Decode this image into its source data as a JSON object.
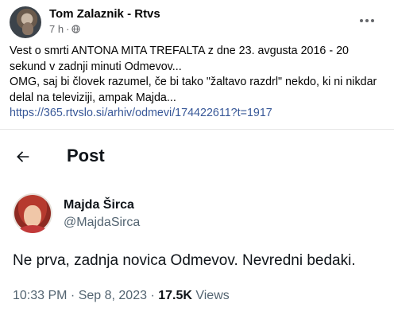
{
  "facebook_post": {
    "author": "Tom Zalaznik - Rtvs",
    "time": "7 h",
    "separator": "·",
    "text_line1": "Vest o smrti ANTONA MITA TREFALTA z dne 23. avgusta 2016 - 20 sekund v zadnji minuti Odmevov...",
    "text_line2": "OMG, saj bi človek razumel, če bi tako \"žaltavo razdrl\" nekdo, ki ni nikdar delal na televiziji, ampak Majda...",
    "link": "https://365.rtvslo.si/arhiv/odmevi/174422611?t=1917"
  },
  "tweet": {
    "page_title": "Post",
    "author_name": "Majda Širca",
    "author_handle": "@MajdaSirca",
    "text": "Ne prva, zadnja novica Odmevov. Nevredni bedaki.",
    "timestamp": "10:33 PM · Sep 8, 2023 · ",
    "views_count": "17.5K",
    "views_label": " Views"
  },
  "colors": {
    "fb_link": "#385898",
    "fb_meta": "#65676b",
    "tw_text": "#0f1419",
    "tw_secondary": "#536471"
  },
  "icons": {
    "audience": "globe-icon",
    "more": "more-options-icon",
    "back": "back-arrow-icon"
  }
}
